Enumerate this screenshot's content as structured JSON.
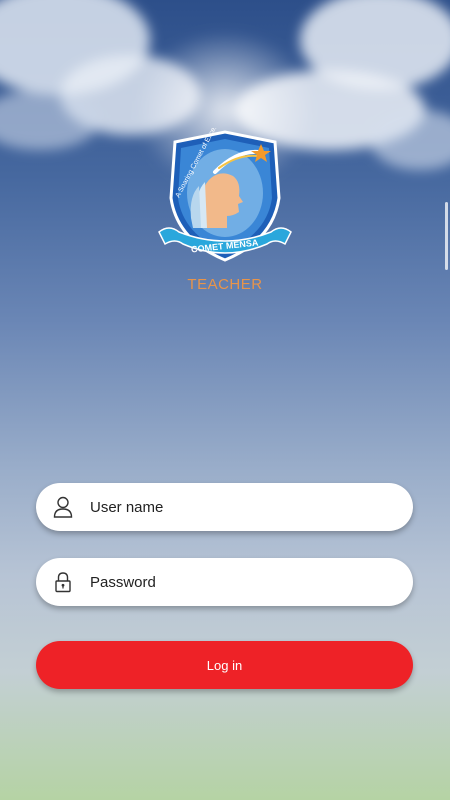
{
  "logo": {
    "motto": "A Soaring Comet of Excellence",
    "banner_text": "COMET MENSA"
  },
  "role_label": "TEACHER",
  "form": {
    "username_placeholder": "User name",
    "password_placeholder": "Password",
    "login_label": "Log in"
  },
  "icons": {
    "username": "user-icon",
    "password": "lock-icon"
  },
  "colors": {
    "login_button": "#ee2227",
    "role_label": "#e8944a",
    "shield_blue": "#1e5fb8",
    "banner_blue": "#2aa7dc"
  }
}
